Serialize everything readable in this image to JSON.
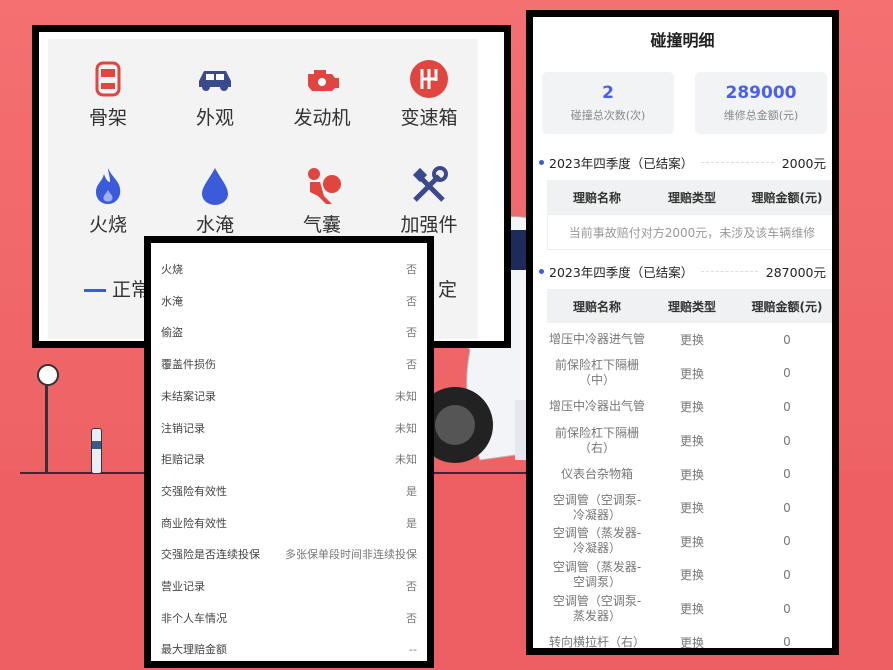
{
  "categories": [
    {
      "label": "骨架",
      "icon": "car-frame-icon",
      "color": "#e0463f"
    },
    {
      "label": "外观",
      "icon": "car-exterior-icon",
      "color": "#3b4a8c"
    },
    {
      "label": "发动机",
      "icon": "engine-icon",
      "color": "#e0463f"
    },
    {
      "label": "变速箱",
      "icon": "gearbox-icon",
      "color": "#e0463f"
    },
    {
      "label": "火烧",
      "icon": "fire-icon",
      "color": "#3b5bdb"
    },
    {
      "label": "水淹",
      "icon": "water-drop-icon",
      "color": "#3b5bdb"
    },
    {
      "label": "气囊",
      "icon": "airbag-icon",
      "color": "#e0463f"
    },
    {
      "label": "加强件",
      "icon": "tools-icon",
      "color": "#3b4a8c"
    }
  ],
  "legend": {
    "normal": "正常",
    "other": "定"
  },
  "records": [
    {
      "label": "火烧",
      "value": "否"
    },
    {
      "label": "水淹",
      "value": "否"
    },
    {
      "label": "偷盗",
      "value": "否"
    },
    {
      "label": "覆盖件损伤",
      "value": "否"
    },
    {
      "label": "未结案记录",
      "value": "未知"
    },
    {
      "label": "注销记录",
      "value": "未知"
    },
    {
      "label": "拒赔记录",
      "value": "未知"
    },
    {
      "label": "交强险有效性",
      "value": "是"
    },
    {
      "label": "商业险有效性",
      "value": "是"
    },
    {
      "label": "交强险是否连续投保",
      "value": "多张保单段时间非连续投保"
    },
    {
      "label": "营业记录",
      "value": "否"
    },
    {
      "label": "非个人车情况",
      "value": "否"
    },
    {
      "label": "最大理赔金额",
      "value": "--"
    }
  ],
  "collision": {
    "title": "碰撞明细",
    "count": "2",
    "count_label": "碰撞总次数(次)",
    "amount": "289000",
    "amount_label": "维修总金额(元)",
    "headers": [
      "理赔名称",
      "理赔类型",
      "理赔金额(元)"
    ],
    "section1": {
      "period": "2023年四季度（已结案）",
      "amount": "2000元",
      "note": "当前事故赔付对方2000元，未涉及该车辆维修"
    },
    "section2": {
      "period": "2023年四季度（已结案）",
      "amount": "287000元",
      "rows": [
        {
          "name": "增压中冷器进气管",
          "type": "更换",
          "amount": "0"
        },
        {
          "name": "前保险杠下隔栅（中）",
          "type": "更换",
          "amount": "0"
        },
        {
          "name": "增压中冷器出气管",
          "type": "更换",
          "amount": "0"
        },
        {
          "name": "前保险杠下隔栅（右）",
          "type": "更换",
          "amount": "0"
        },
        {
          "name": "仪表台杂物箱",
          "type": "更换",
          "amount": "0"
        },
        {
          "name": "空调管（空调泵-冷凝器）",
          "type": "更换",
          "amount": "0"
        },
        {
          "name": "空调管（蒸发器-冷凝器）",
          "type": "更换",
          "amount": "0"
        },
        {
          "name": "空调管（蒸发器-空调泵）",
          "type": "更换",
          "amount": "0"
        },
        {
          "name": "空调管（空调泵-蒸发器）",
          "type": "更换",
          "amount": "0"
        },
        {
          "name": "转向横拉杆（右）",
          "type": "更换",
          "amount": "0"
        }
      ]
    }
  }
}
